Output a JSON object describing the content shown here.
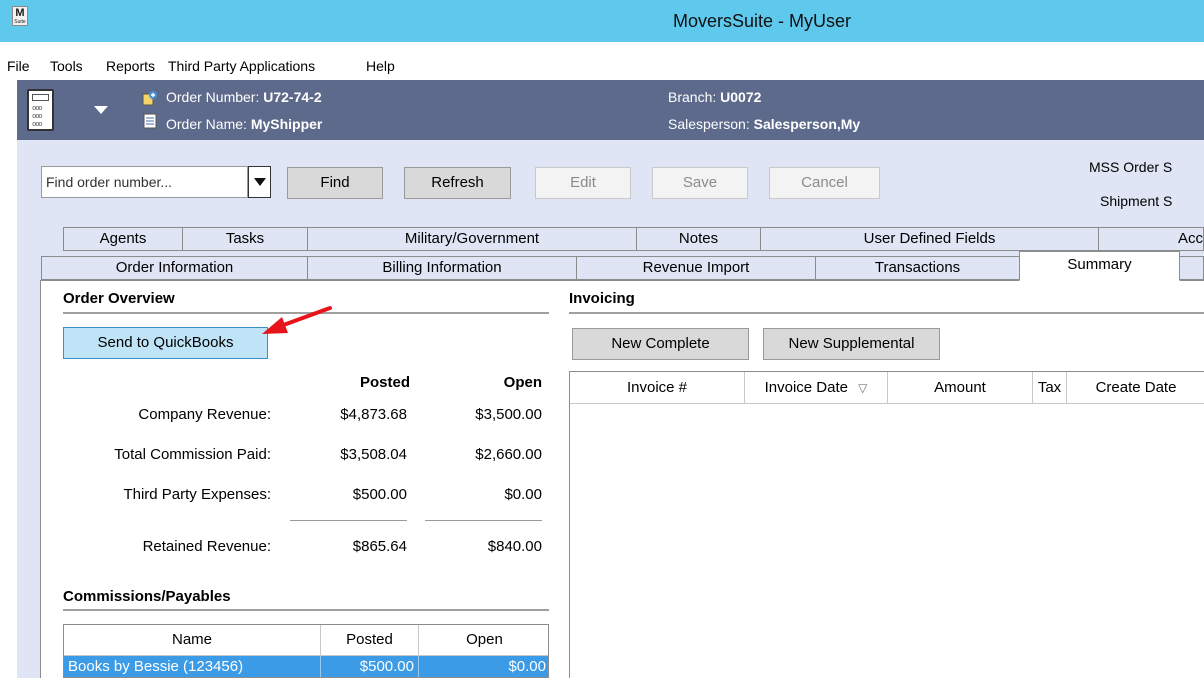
{
  "window": {
    "title": "MoversSuite - MyUser",
    "logo_text": "M"
  },
  "menu": [
    "File",
    "Tools",
    "Reports",
    "Third Party Applications",
    "Help"
  ],
  "order_header": {
    "order_number_label": "Order Number:",
    "order_number": "U72-74-2",
    "order_name_label": "Order Name:",
    "order_name": "MyShipper",
    "branch_label": "Branch:",
    "branch": "U0072",
    "salesperson_label": "Salesperson:",
    "salesperson": "Salesperson,My"
  },
  "toolbar": {
    "find_placeholder": "Find order number...",
    "find": "Find",
    "refresh": "Refresh",
    "edit": "Edit",
    "save": "Save",
    "cancel": "Cancel",
    "status_1": "MSS Order S",
    "status_2": "Shipment S"
  },
  "tabs_row1": [
    "Agents",
    "Tasks",
    "Military/Government",
    "Notes",
    "User Defined Fields",
    "Acc"
  ],
  "tabs_row2": [
    "Order Information",
    "Billing Information",
    "Revenue Import",
    "Transactions",
    "Summary"
  ],
  "order_overview": {
    "title": "Order Overview",
    "send_button": "Send to QuickBooks",
    "col_posted": "Posted",
    "col_open": "Open",
    "rows": [
      {
        "label": "Company Revenue:",
        "posted": "$4,873.68",
        "open": "$3,500.00"
      },
      {
        "label": "Total Commission Paid:",
        "posted": "$3,508.04",
        "open": "$2,660.00"
      },
      {
        "label": "Third Party Expenses:",
        "posted": "$500.00",
        "open": "$0.00"
      },
      {
        "label": "Retained Revenue:",
        "posted": "$865.64",
        "open": "$840.00"
      }
    ]
  },
  "commissions": {
    "title": "Commissions/Payables",
    "columns": [
      "Name",
      "Posted",
      "Open"
    ],
    "rows": [
      {
        "name": "Books by Bessie (123456)",
        "posted": "$500.00",
        "open": "$0.00"
      }
    ]
  },
  "invoicing": {
    "title": "Invoicing",
    "new_complete": "New Complete",
    "new_supplemental": "New Supplemental",
    "columns": [
      "Invoice #",
      "Invoice Date",
      "Amount",
      "Tax",
      "Create Date"
    ],
    "sort_indicator": "▽"
  }
}
